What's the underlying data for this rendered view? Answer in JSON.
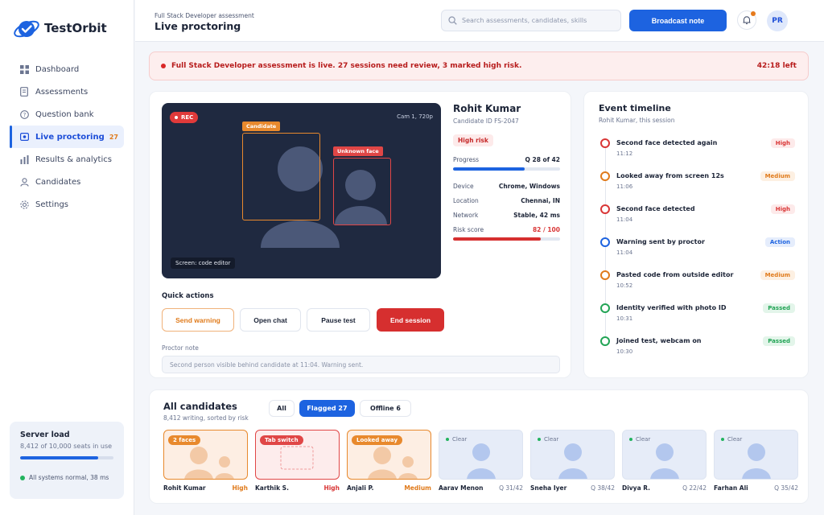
{
  "app": {
    "name": "TestOrbit"
  },
  "sidebar": {
    "items": [
      {
        "label": "Dashboard",
        "icon": "grid-icon"
      },
      {
        "label": "Assessments",
        "icon": "document-icon"
      },
      {
        "label": "Question bank",
        "icon": "question-icon"
      },
      {
        "label": "Live proctoring",
        "icon": "camera-icon",
        "badge": "27",
        "active": true
      },
      {
        "label": "Results & analytics",
        "icon": "bar-chart-icon"
      },
      {
        "label": "Candidates",
        "icon": "user-icon"
      },
      {
        "label": "Settings",
        "icon": "gear-icon"
      }
    ],
    "server": {
      "title": "Server load",
      "subtitle": "8,412 of 10,000 seats in use",
      "load_fraction": 0.84,
      "status": "All systems normal, 38 ms"
    }
  },
  "header": {
    "breadcrumb": "Full Stack Developer assessment",
    "title": "Live proctoring",
    "search_placeholder": "Search assessments, candidates, skills",
    "broadcast_label": "Broadcast note",
    "avatar_initials": "PR"
  },
  "alert": {
    "message": "Full Stack Developer assessment is live. 27 sessions need review, 3 marked high risk.",
    "time_left": "42:18 left"
  },
  "session": {
    "rec_label": "REC",
    "camera": "Cam 1, 720p",
    "screen_label": "Screen: code editor",
    "candidate_box_label": "Candidate",
    "unknown_box_label": "Unknown face",
    "name": "Rohit Kumar",
    "candidate_id": "Candidate ID FS-2047",
    "risk_label": "High risk",
    "progress_label": "Progress",
    "progress_value": "Q 28 of 42",
    "progress_fraction": 0.667,
    "device_label": "Device",
    "device_value": "Chrome, Windows",
    "location_label": "Location",
    "location_value": "Chennai, IN",
    "network_label": "Network",
    "network_value": "Stable, 42 ms",
    "risk_score_label": "Risk score",
    "risk_score_value": "82 / 100",
    "risk_fraction": 0.82,
    "quick_actions_title": "Quick actions",
    "actions": {
      "send_warning": "Send warning",
      "open_chat": "Open chat",
      "pause_test": "Pause test",
      "end_session": "End session"
    },
    "note_label": "Proctor note",
    "note_text": "Second person visible behind candidate at 11:04. Warning sent."
  },
  "timeline": {
    "title": "Event timeline",
    "subtitle": "Rohit Kumar, this session",
    "events": [
      {
        "title": "Second face detected again",
        "time": "11:12",
        "tag": "High",
        "color": "#d93636"
      },
      {
        "title": "Looked away from screen 12s",
        "time": "11:06",
        "tag": "Medium",
        "color": "#e07b1c"
      },
      {
        "title": "Second face detected",
        "time": "11:04",
        "tag": "High",
        "color": "#d93636"
      },
      {
        "title": "Warning sent by proctor",
        "time": "11:04",
        "tag": "Action",
        "color": "#1d63e0"
      },
      {
        "title": "Pasted code from outside editor",
        "time": "10:52",
        "tag": "Medium",
        "color": "#e07b1c"
      },
      {
        "title": "Identity verified with photo ID",
        "time": "10:31",
        "tag": "Passed",
        "color": "#22a455"
      },
      {
        "title": "Joined test, webcam on",
        "time": "10:30",
        "tag": "Passed",
        "color": "#22a455"
      }
    ]
  },
  "candidates": {
    "title": "All candidates",
    "subtitle": "8,412 writing, sorted by risk",
    "filters": {
      "all": "All",
      "flagged": "Flagged 27",
      "offline": "Offline 6"
    },
    "tiles": [
      {
        "name": "Rohit Kumar",
        "tag": "2 faces",
        "right": "High",
        "kind": "high-faces"
      },
      {
        "name": "Karthik S.",
        "tag": "Tab switch",
        "right": "High",
        "kind": "high-tab"
      },
      {
        "name": "Anjali P.",
        "tag": "Looked away",
        "right": "Medium",
        "kind": "medium"
      },
      {
        "name": "Aarav Menon",
        "tag": "Clear",
        "right": "Q 31/42",
        "kind": "clear"
      },
      {
        "name": "Sneha Iyer",
        "tag": "Clear",
        "right": "Q 38/42",
        "kind": "clear"
      },
      {
        "name": "Divya R.",
        "tag": "Clear",
        "right": "Q 22/42",
        "kind": "clear"
      },
      {
        "name": "Farhan Ali",
        "tag": "Clear",
        "right": "Q 35/42",
        "kind": "clear"
      }
    ]
  },
  "colors": {
    "primary": "#1d63e0",
    "danger": "#d93636",
    "warning": "#e07b1c",
    "success": "#22a455"
  }
}
